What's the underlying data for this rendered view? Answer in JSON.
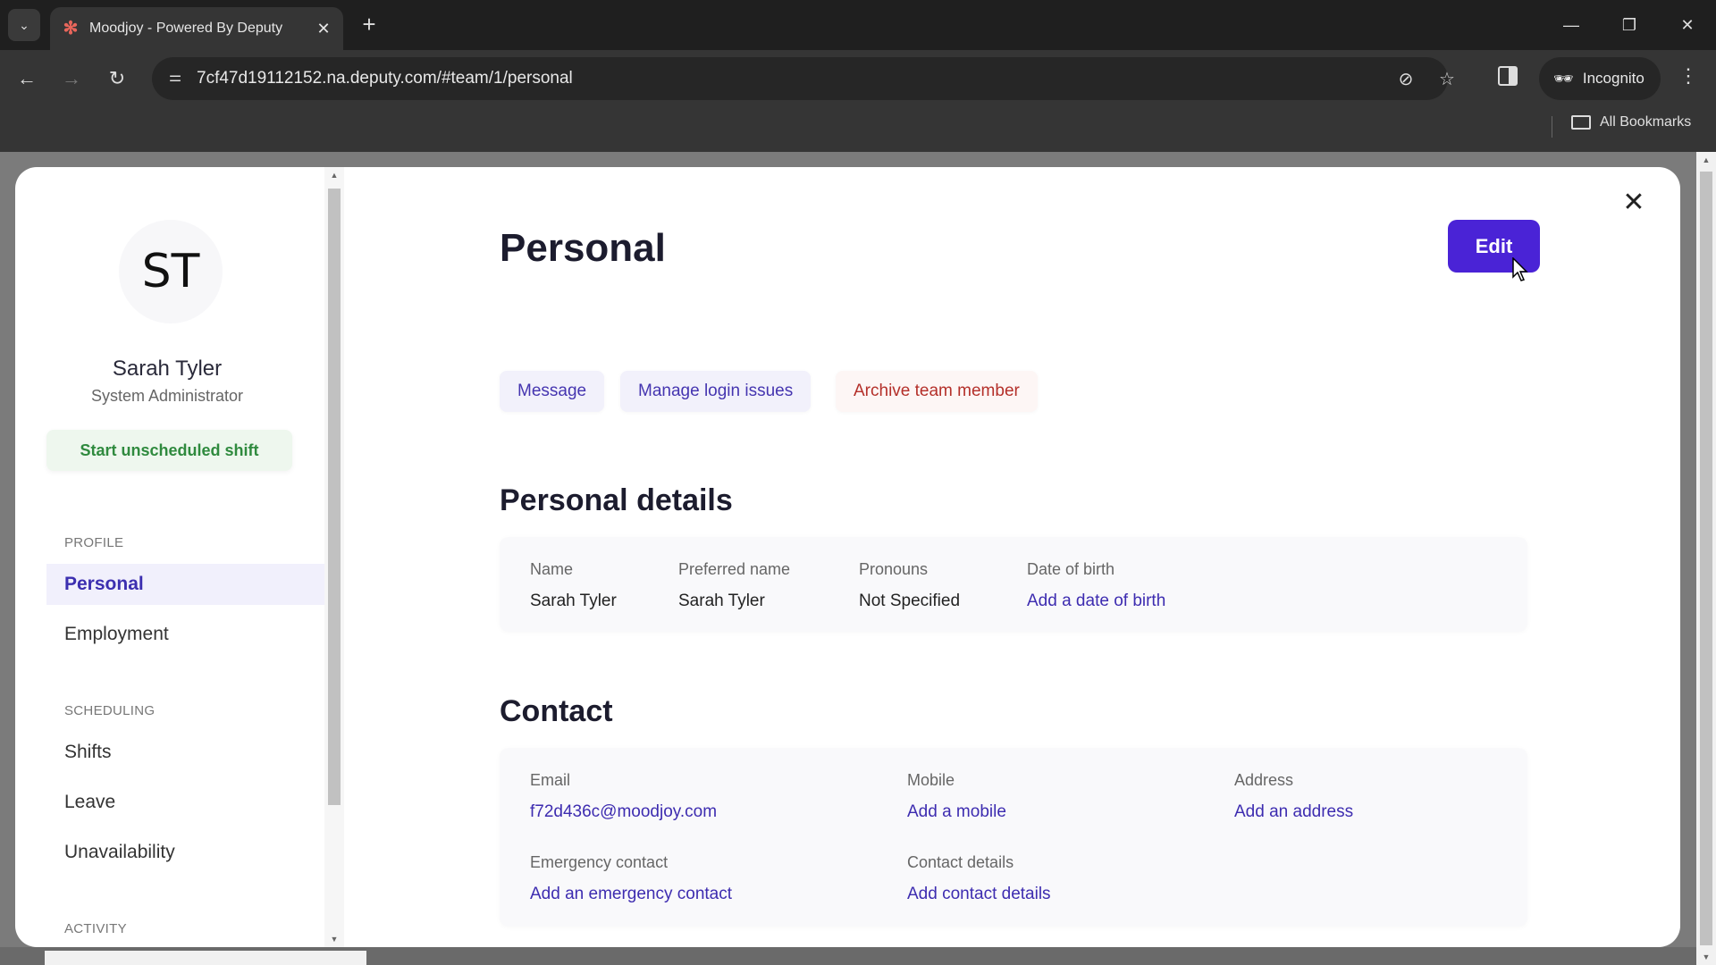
{
  "browser": {
    "tab_title": "Moodjoy - Powered By Deputy",
    "url": "7cf47d19112152.na.deputy.com/#team/1/personal",
    "profile_label": "Incognito",
    "bookmarks_label": "All Bookmarks",
    "icons": {
      "tab_search": "chevron-down-icon",
      "favicon": "deputy-logo-icon",
      "close_tab": "close-icon",
      "new_tab": "plus-icon",
      "back": "arrow-left-icon",
      "forward": "arrow-right-icon",
      "reload": "reload-icon",
      "site_info": "tune-icon",
      "tracking": "eye-off-icon",
      "bookmark": "star-icon",
      "side_panel": "side-panel-icon",
      "incognito": "incognito-icon",
      "menu": "more-vert-icon",
      "folder": "folder-icon"
    },
    "glyphs": {
      "chevron": "⌄",
      "favicon": "✻",
      "close": "✕",
      "plus": "+",
      "back": "←",
      "forward": "→",
      "reload": "↻",
      "site_info": "⚌",
      "eye_off": "⊘",
      "star": "☆",
      "incognito": "🕵",
      "menu": "⋮",
      "minimize": "—",
      "restore": "❐",
      "win_close": "✕"
    }
  },
  "sidebar": {
    "avatar_initials": "ST",
    "name": "Sarah Tyler",
    "role": "System Administrator",
    "shift_button": "Start unscheduled shift",
    "sections": [
      {
        "title": "PROFILE",
        "items": [
          {
            "label": "Personal",
            "active": true
          },
          {
            "label": "Employment",
            "active": false
          }
        ]
      },
      {
        "title": "SCHEDULING",
        "items": [
          {
            "label": "Shifts",
            "active": false
          },
          {
            "label": "Leave",
            "active": false
          },
          {
            "label": "Unavailability",
            "active": false
          }
        ]
      },
      {
        "title": "ACTIVITY",
        "items": []
      }
    ]
  },
  "main": {
    "title": "Personal",
    "edit_label": "Edit",
    "close_glyph": "✕",
    "actions": [
      {
        "label": "Message",
        "variant": "purple"
      },
      {
        "label": "Manage login issues",
        "variant": "purple"
      },
      {
        "label": "Archive team member",
        "variant": "red"
      }
    ],
    "personal_details": {
      "title": "Personal details",
      "fields": [
        {
          "label": "Name",
          "value": "Sarah Tyler",
          "is_link": false
        },
        {
          "label": "Preferred name",
          "value": "Sarah Tyler",
          "is_link": false
        },
        {
          "label": "Pronouns",
          "value": "Not Specified",
          "is_link": false
        },
        {
          "label": "Date of birth",
          "value": "Add a date of birth",
          "is_link": true
        }
      ]
    },
    "contact": {
      "title": "Contact",
      "fields": [
        {
          "label": "Email",
          "value": "f72d436c@moodjoy.com",
          "is_link": true
        },
        {
          "label": "Mobile",
          "value": "Add a mobile",
          "is_link": true
        },
        {
          "label": "Address",
          "value": "Add an address",
          "is_link": true
        },
        {
          "label": "Emergency contact",
          "value": "Add an emergency contact",
          "is_link": true
        },
        {
          "label": "Contact details",
          "value": "Add contact details",
          "is_link": true
        }
      ]
    }
  },
  "colors": {
    "brand_purple": "#4a23d6",
    "link_purple": "#3d2cb0",
    "danger_red": "#b4302a",
    "success_green": "#2f8a3e"
  }
}
